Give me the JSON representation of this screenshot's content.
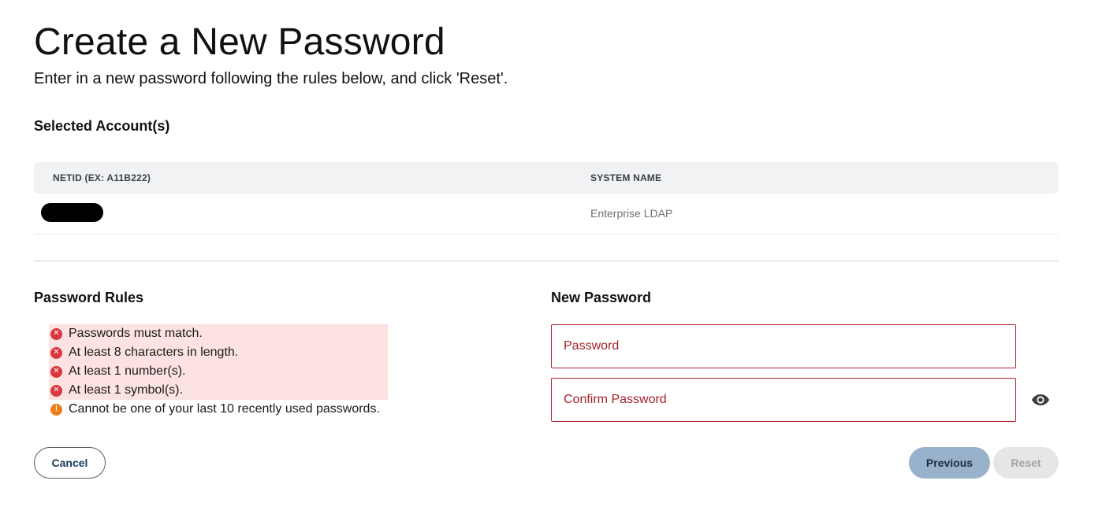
{
  "page": {
    "title": "Create a New Password",
    "subtitle": "Enter in a new password following the rules below, and click 'Reset'."
  },
  "accounts": {
    "heading": "Selected Account(s)",
    "columns": [
      "NETID (EX: A11B222)",
      "SYSTEM NAME"
    ],
    "rows": [
      {
        "netid": "",
        "system_name": "Enterprise LDAP"
      }
    ]
  },
  "rules": {
    "heading": "Password Rules",
    "items": [
      {
        "text": "Passwords must match.",
        "status": "error",
        "icon": "error-circle-icon"
      },
      {
        "text": "At least 8 characters in length.",
        "status": "error",
        "icon": "error-circle-icon"
      },
      {
        "text": "At least 1 number(s).",
        "status": "error",
        "icon": "error-circle-icon"
      },
      {
        "text": "At least 1 symbol(s).",
        "status": "error",
        "icon": "error-circle-icon"
      },
      {
        "text": "Cannot be one of your last 10 recently used passwords.",
        "status": "warning",
        "icon": "warning-circle-icon"
      }
    ]
  },
  "new_password": {
    "heading": "New Password",
    "password_placeholder": "Password",
    "password_value": "",
    "confirm_placeholder": "Confirm Password",
    "confirm_value": "",
    "show_toggle_icon": "eye-icon"
  },
  "buttons": {
    "cancel": "Cancel",
    "previous": "Previous",
    "reset": "Reset"
  },
  "colors": {
    "error": "#d9363e",
    "warning": "#ef7d1a",
    "error_bg": "#fde2e2",
    "field_border": "#b3262e",
    "previous_bg": "#98b2cc",
    "reset_disabled_bg": "#e6e6e6"
  }
}
